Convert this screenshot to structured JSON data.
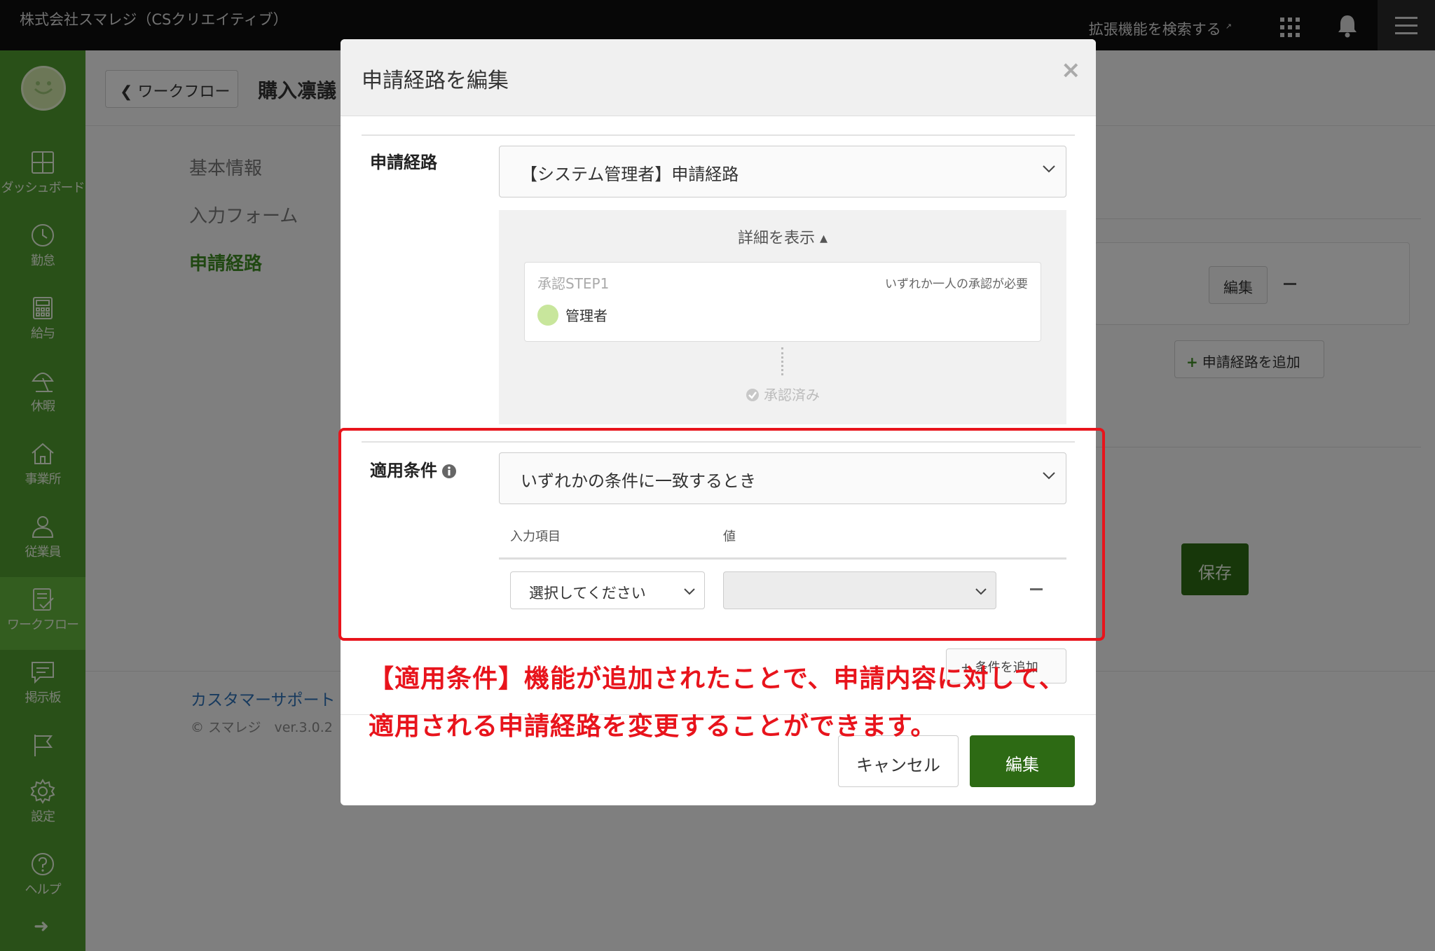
{
  "topbar": {
    "company": "株式会社スマレジ（CSクリエイティブ）",
    "extension_search": "拡張機能を検索する",
    "icons": [
      "apps-grid-icon",
      "bell-icon",
      "hamburger-menu-icon"
    ]
  },
  "sidebar": {
    "items": [
      {
        "label": "ダッシュボード",
        "icon": "dashboard-icon"
      },
      {
        "label": "勤怠",
        "icon": "clock-icon"
      },
      {
        "label": "給与",
        "icon": "calculator-icon"
      },
      {
        "label": "休暇",
        "icon": "parasol-icon"
      },
      {
        "label": "事業所",
        "icon": "home-icon"
      },
      {
        "label": "従業員",
        "icon": "person-icon"
      },
      {
        "label": "ワークフロー",
        "icon": "checklist-icon",
        "active": true
      },
      {
        "label": "掲示板",
        "icon": "chat-icon"
      },
      {
        "label": "",
        "icon": "flag-icon"
      },
      {
        "label": "設定",
        "icon": "gear-icon"
      },
      {
        "label": "ヘルプ",
        "icon": "help-icon"
      }
    ]
  },
  "page": {
    "back_button": "ワークフロー",
    "title": "購入凛議",
    "nav": [
      "基本情報",
      "入力フォーム",
      "申請経路"
    ],
    "edit_button": "編集",
    "add_route_button": "申請経路を追加",
    "save_button": "保存",
    "support_link": "カスタマーサポート",
    "copyright": "© スマレジ　ver.3.0.2"
  },
  "modal": {
    "title": "申請経路を編集",
    "route_label": "申請経路",
    "route_value": "【システム管理者】申請経路",
    "detail_toggle": "詳細を表示",
    "step": {
      "name": "承認STEP1",
      "requirement": "いずれか一人の承認が必要",
      "approver": "管理者"
    },
    "approved": "承認済み",
    "condition_label": "適用条件",
    "condition_value": "いずれかの条件に一致するとき",
    "col_input": "入力項目",
    "col_value": "値",
    "input_select": "選択してください",
    "value_select": "",
    "add_condition": "条件を追加",
    "cancel": "キャンセル",
    "submit": "編集"
  },
  "annotation": {
    "line1": "【適用条件】機能が追加されたことで、申請内容に対して、",
    "line2": "適用される申請経路を変更することができます。",
    "color": "#e8141c"
  },
  "colors": {
    "sidebar": "#4f9a2f",
    "primary_button": "#2d6a14",
    "topbar": "#0e0e0e"
  }
}
